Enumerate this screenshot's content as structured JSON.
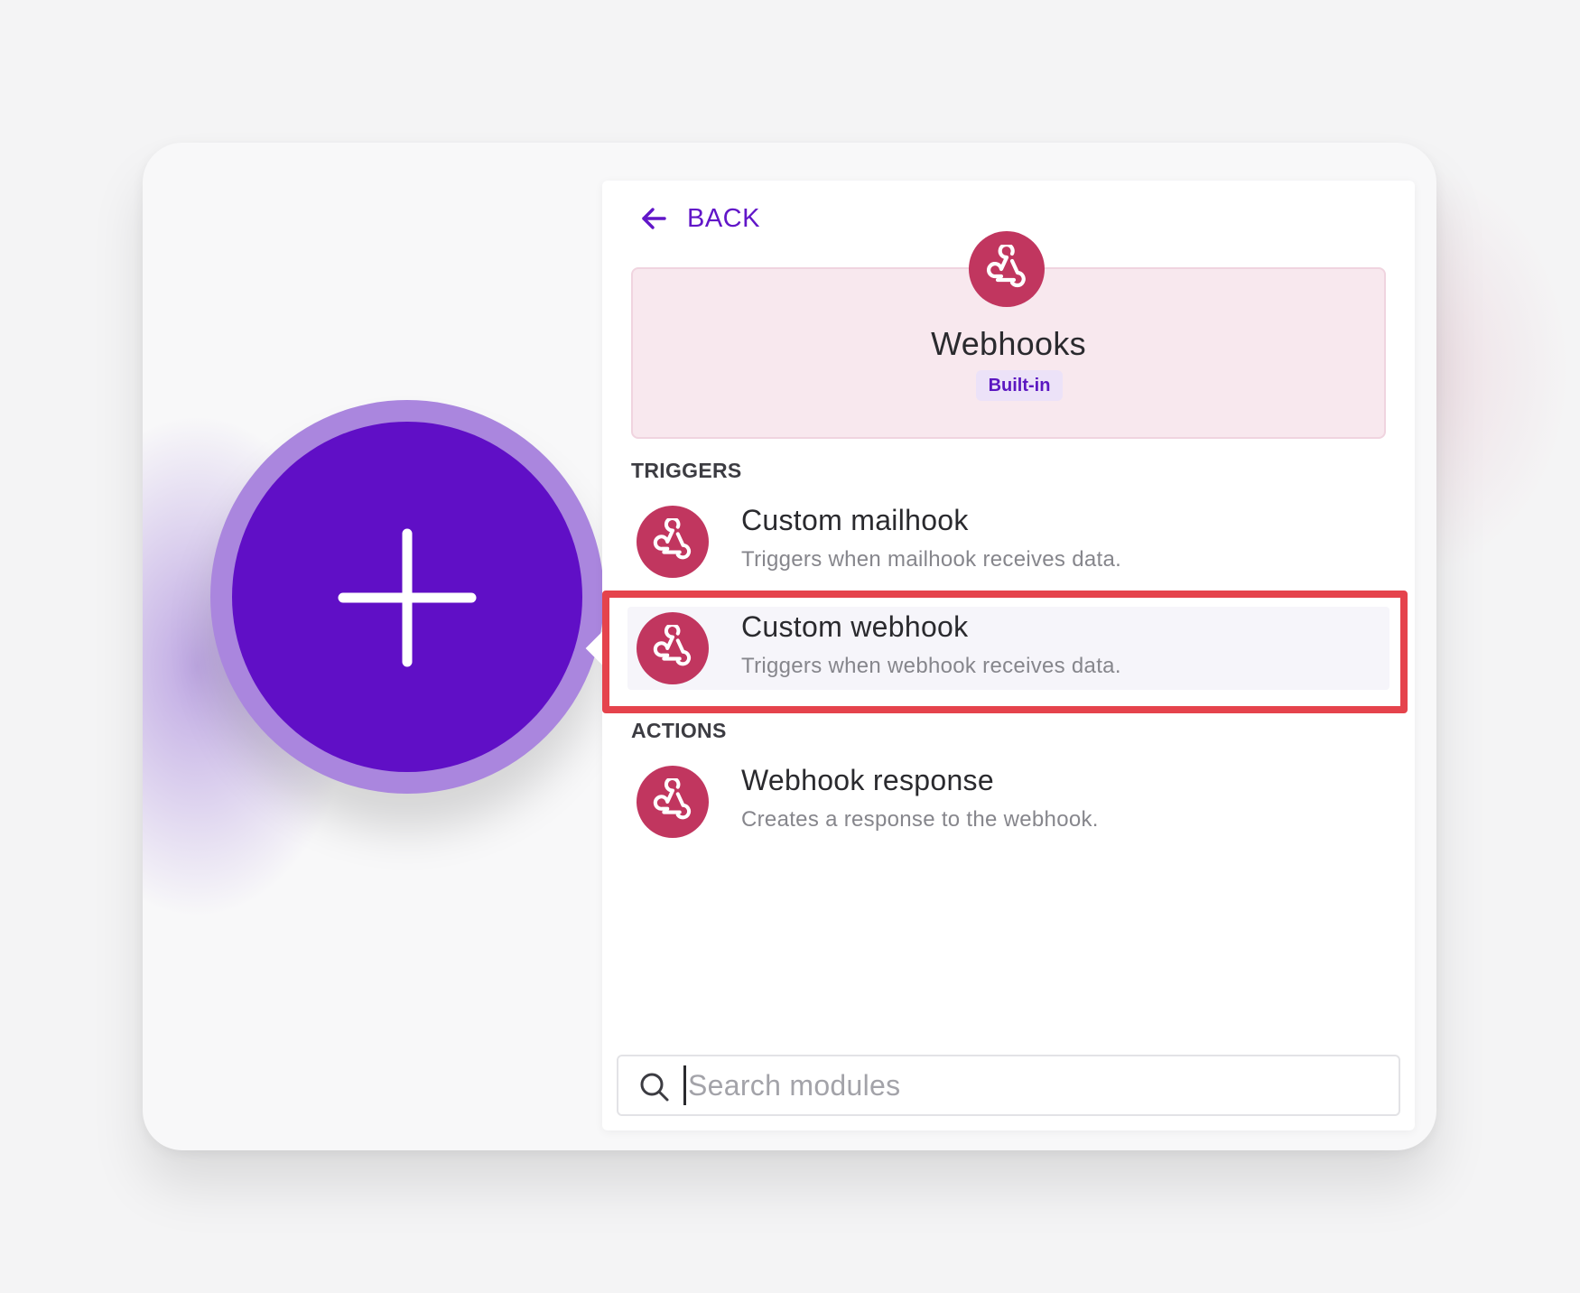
{
  "panel": {
    "back_label": "BACK",
    "app": {
      "name": "Webhooks",
      "badge": "Built-in",
      "icon": "webhook-icon",
      "color": "#c1365f",
      "header_bg": "#f8e8ee"
    },
    "triggers_label": "TRIGGERS",
    "actions_label": "ACTIONS",
    "triggers": [
      {
        "title": "Custom mailhook",
        "description": "Triggers when mailhook receives data."
      },
      {
        "title": "Custom webhook",
        "description": "Triggers when webhook receives data."
      }
    ],
    "actions": [
      {
        "title": "Webhook response",
        "description": "Creates a response to the webhook."
      }
    ],
    "search": {
      "placeholder": "Search modules",
      "value": ""
    }
  },
  "add_module": {
    "icon": "plus-icon",
    "color": "#600fc6",
    "ring_color": "#aa86de"
  },
  "highlight": {
    "target": "Custom webhook",
    "color": "#e5434c"
  },
  "accent_color": "#6116c8"
}
